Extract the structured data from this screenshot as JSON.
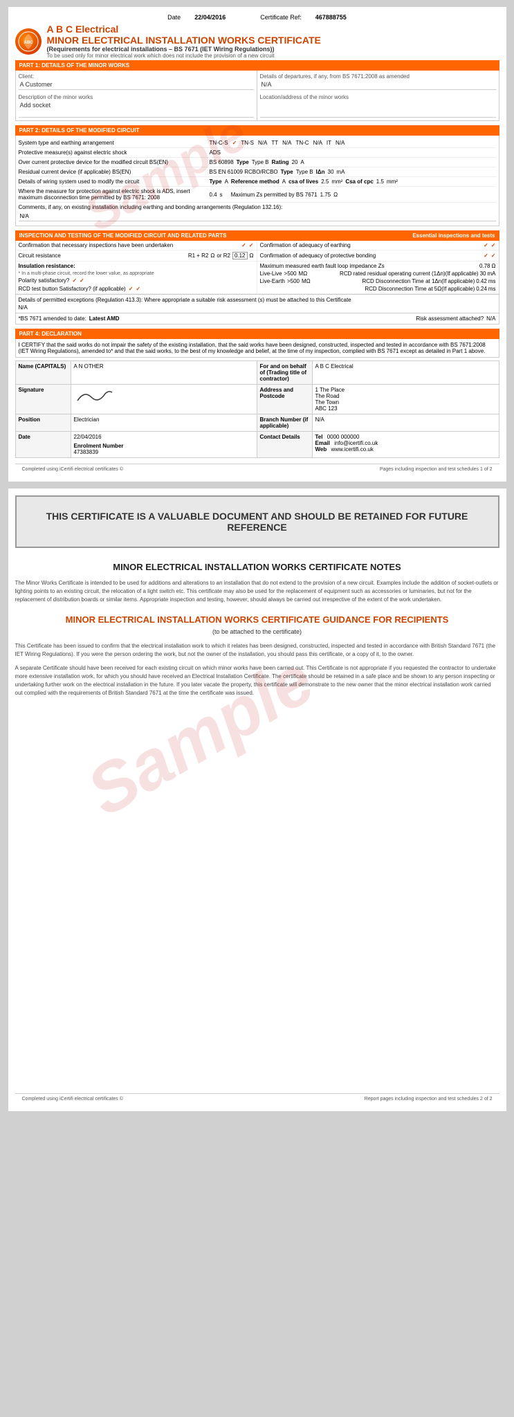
{
  "header": {
    "date_label": "Date",
    "date_value": "22/04/2016",
    "cert_ref_label": "Certificate Ref:",
    "cert_ref_value": "467888755",
    "company_name": "A B C Electrical",
    "cert_title": "MINOR ELECTRICAL INSTALLATION WORKS CERTIFICATE",
    "subtitle": "(Requirements for electrical installations – BS 7671 (IET Wiring Regulations))",
    "note": "To be used only for minor electrical work which does not include the provision of a new circuit"
  },
  "part1": {
    "title": "PART 1: DETAILS OF THE MINOR WORKS",
    "client_label": "Client:",
    "client_value": "A Customer",
    "description_label": "Description of the minor works",
    "description_value": "Add socket",
    "departures_label": "Details of departures, if any, from BS 7671:2008 as amended",
    "departures_value": "N/A",
    "location_label": "Location/address of the minor works",
    "location_value": ""
  },
  "part2": {
    "title": "PART 2: DETAILS OF THE MODIFIED CIRCUIT",
    "system_type_label": "System type and earthing arrangement",
    "system_values": [
      {
        "label": "TN-C-S",
        "checked": true
      },
      {
        "label": "TN-S",
        "value": "N/A"
      },
      {
        "label": "TT",
        "value": "N/A"
      },
      {
        "label": "TN-C",
        "value": "N/A"
      },
      {
        "label": "IT",
        "value": "N/A"
      }
    ],
    "protective_label": "Protective measure(s) against electric shock",
    "protective_value": "ADS",
    "overcurrent_label": "Over current protective device for the modified circuit BS(EN)",
    "overcurrent_bs": "BS 60898",
    "overcurrent_type_label": "Type",
    "overcurrent_type": "Type B",
    "overcurrent_rating_label": "Rating",
    "overcurrent_rating": "20",
    "overcurrent_unit": "A",
    "rcd_label": "Residual current device (if applicable) BS(EN)",
    "rcd_bs": "BS EN 61009 RCBO/RCBO",
    "rcd_type_label": "Type",
    "rcd_type": "Type B",
    "rcd_idn_label": "IΔn",
    "rcd_idn": "30",
    "rcd_unit": "mA",
    "wiring_label": "Details of wiring system used to modify the circuit",
    "wiring_type_label": "Type",
    "wiring_type": "A",
    "wiring_ref_label": "Reference method",
    "wiring_ref": "A",
    "wiring_csa_label": "csa of lives",
    "wiring_csa": "2.5",
    "wiring_csa_unit": "mm²",
    "wiring_cpc_label": "Csa of cpc",
    "wiring_cpc": "1.5",
    "wiring_cpc_unit": "mm²",
    "protection_label": "Where the measure for protection against electric shock is ADS, insert maximum disconnection time permitted by BS 7671: 2008",
    "protection_value": "0.4",
    "protection_unit": "s",
    "max_zs_label": "Maximum Zs permitted by BS 7671",
    "max_zs_value": "1.75",
    "max_zs_unit": "Ω",
    "comments_label": "Comments, if any, on existing installation including earthing and bonding arrangements (Regulation 132.16):",
    "comments_value": "N/A"
  },
  "part3": {
    "title": "INSPECTION AND TESTING OF THE MODIFIED CIRCUIT AND RELATED PARTS",
    "essential_label": "Essential inspections and tests",
    "confirm_inspections_label": "Confirmation that necessary inspections have been undertaken",
    "confirm_inspections_check1": "✓",
    "confirm_inspections_check2": "✓",
    "confirm_earthing_label": "Confirmation of adequacy of earthing",
    "confirm_earthing_check1": "✓",
    "confirm_earthing_check2": "✓",
    "circuit_resistance_label": "Circuit resistance",
    "r1_r2_label": "R1 + R2",
    "r1_r2_unit": "Ω",
    "or_r2_label": "or R2",
    "or_r2_value": "0.12",
    "or_r2_unit": "Ω",
    "confirm_bonding_label": "Confirmation of adequacy of protective bonding",
    "confirm_bonding_check1": "✓",
    "confirm_bonding_check2": "✓",
    "insulation_label": "Insulation resistance:",
    "insulation_note": "* In a multi-phase circuit, record the lower value, as appropriate",
    "polarity_label": "Polarity satisfactory?",
    "polarity_check1": "✓",
    "polarity_check2": "✓",
    "rcd_test_label": "RCD test button Satisfactory? (if applicable)",
    "rcd_test_check1": "✓",
    "rcd_test_check2": "✓",
    "max_earth_label": "Maximum measured earth fault loop impedance Zs",
    "max_earth_value": "0.78",
    "max_earth_unit": "Ω",
    "live_live_label": "Live-Live",
    "live_live_value": ">500",
    "live_live_unit": "MΩ",
    "rcd_rated_label": "RCD rated residual operating current (1Δn)(If applicable)",
    "rcd_rated_value": "30",
    "rcd_rated_unit": "mA",
    "live_earth_label": "Live-Earth",
    "live_earth_value": ">500",
    "live_earth_unit": "MΩ",
    "rcd_disc_1_label": "RCD Disconnection Time at 1Δn(If applicable)",
    "rcd_disc_1_value": "0.42",
    "rcd_disc_1_unit": "ms",
    "rcd_disc_5_label": "RCD Disconnection Time at 5Ω(If applicable)",
    "rcd_disc_5_value": "0.24",
    "rcd_disc_5_unit": "ms",
    "details_label": "Details of permitted exceptions (Regulation 413.3): Where appropriate a suitable risk assessment (s) must be attached to this Certificate",
    "details_value": "N/A",
    "bs7671_label": "*BS 7671 amended to date:",
    "bs7671_value": "Latest AMD",
    "risk_label": "Risk assessment attached?",
    "risk_value": "N/A"
  },
  "part4": {
    "title": "PART 4: DECLARATION",
    "declaration_text": "I CERTIFY that the said works do not impair the safety of the existing installation, that the said works have been designed, constructed, inspected and tested in accordance with BS 7671:2008 (IET Wiring Regulations), amended to* and that the said works, to the best of my knowledge and belief, at the time of my inspection, complied with BS 7671 except as detailed in Part 1 above.",
    "name_label": "Name (CAPITALS)",
    "name_value": "A N OTHER",
    "for_label": "For and on behalf of (Trading title of contractor)",
    "for_value": "A B C Electrical",
    "signature_label": "Signature",
    "address_label": "Address and Postcode",
    "address_value": "1 The Place\nThe Road\nThe Town\nABC 123",
    "position_label": "Position",
    "position_value": "Electrician",
    "branch_label": "Branch Number (if applicable)",
    "branch_value": "N/A",
    "date_label": "Date",
    "date_value": "22/04/2016",
    "contact_label": "Contact Details",
    "tel_label": "Tel",
    "tel_value": "0000 000000",
    "email_label": "Email",
    "email_value": "info@icertifi.co.uk",
    "web_label": "Web",
    "web_value": "www.icertifi.co.uk",
    "enrolment_label": "Enrolment Number",
    "enrolment_value": "47383839"
  },
  "footer1": {
    "left": "Completed using iCertifi electrical certificates ©",
    "right": "Pages including inspection and test schedules 1 of 2"
  },
  "page2": {
    "banner_text": "THIS CERTIFICATE IS A VALUABLE DOCUMENT AND SHOULD BE RETAINED FOR FUTURE REFERENCE",
    "notes_title": "MINOR ELECTRICAL INSTALLATION WORKS CERTIFICATE NOTES",
    "notes_text": "The Minor Works Certificate is intended to be used for additions and alterations to an installation that do not extend to the provision of a new circuit. Examples include the addition of socket-outlets or lighting points to an existing circuit, the relocation of a light switch etc. This certificate may also be used for the replacement of equipment such as accessories or luminaries, but not for the replacement of distribution boards or similar items. Appropriate inspection and testing, however, should always be carried out irrespective of the extent of the work undertaken.",
    "guidance_title": "MINOR ELECTRICAL INSTALLATION WORKS CERTIFICATE GUIDANCE FOR RECIPIENTS",
    "guidance_sub": "(to be attached to the certificate)",
    "guidance_text1": "This Certificate has been issued to confirm that the electrical installation work to which it relates has been designed, constructed, inspected and tested in accordance with British Standard 7671 (the IET Wiring Regulations). If you were the person ordering the work, but not the owner of the installation, you should pass this certificate, or a copy of it, to the owner.",
    "guidance_text2": "A separate Certificate should have been received for each existing circuit on which minor works have been carried out. This Certificate is not appropriate if you requested the contractor to undertake more extensive installation work, for which you should have received an Electrical Installation Certificate. The certificate should be retained in a safe place and be shown to any person inspecting or undertaking further work on the electrical installation in the future. If you later vacate the property, this certificate will demonstrate to the new owner that the minor electrical installation work carried out complied with the requirements of British Standard 7671 at the time the certificate was issued."
  },
  "footer2": {
    "left": "Completed using iCertifi electrical certificates ©",
    "right": "Report pages including inspection and test schedules 2 of 2"
  }
}
